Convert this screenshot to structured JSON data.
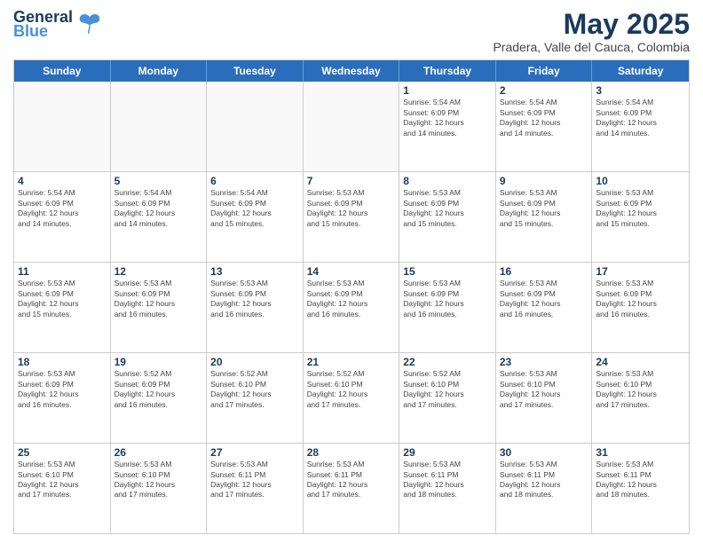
{
  "header": {
    "logo_line1": "General",
    "logo_line2": "Blue",
    "month": "May 2025",
    "location": "Pradera, Valle del Cauca, Colombia"
  },
  "weekdays": [
    "Sunday",
    "Monday",
    "Tuesday",
    "Wednesday",
    "Thursday",
    "Friday",
    "Saturday"
  ],
  "rows": [
    [
      {
        "day": "",
        "info": ""
      },
      {
        "day": "",
        "info": ""
      },
      {
        "day": "",
        "info": ""
      },
      {
        "day": "",
        "info": ""
      },
      {
        "day": "1",
        "info": "Sunrise: 5:54 AM\nSunset: 6:09 PM\nDaylight: 12 hours\nand 14 minutes."
      },
      {
        "day": "2",
        "info": "Sunrise: 5:54 AM\nSunset: 6:09 PM\nDaylight: 12 hours\nand 14 minutes."
      },
      {
        "day": "3",
        "info": "Sunrise: 5:54 AM\nSunset: 6:09 PM\nDaylight: 12 hours\nand 14 minutes."
      }
    ],
    [
      {
        "day": "4",
        "info": "Sunrise: 5:54 AM\nSunset: 6:09 PM\nDaylight: 12 hours\nand 14 minutes."
      },
      {
        "day": "5",
        "info": "Sunrise: 5:54 AM\nSunset: 6:09 PM\nDaylight: 12 hours\nand 14 minutes."
      },
      {
        "day": "6",
        "info": "Sunrise: 5:54 AM\nSunset: 6:09 PM\nDaylight: 12 hours\nand 15 minutes."
      },
      {
        "day": "7",
        "info": "Sunrise: 5:53 AM\nSunset: 6:09 PM\nDaylight: 12 hours\nand 15 minutes."
      },
      {
        "day": "8",
        "info": "Sunrise: 5:53 AM\nSunset: 6:09 PM\nDaylight: 12 hours\nand 15 minutes."
      },
      {
        "day": "9",
        "info": "Sunrise: 5:53 AM\nSunset: 6:09 PM\nDaylight: 12 hours\nand 15 minutes."
      },
      {
        "day": "10",
        "info": "Sunrise: 5:53 AM\nSunset: 6:09 PM\nDaylight: 12 hours\nand 15 minutes."
      }
    ],
    [
      {
        "day": "11",
        "info": "Sunrise: 5:53 AM\nSunset: 6:09 PM\nDaylight: 12 hours\nand 15 minutes."
      },
      {
        "day": "12",
        "info": "Sunrise: 5:53 AM\nSunset: 6:09 PM\nDaylight: 12 hours\nand 16 minutes."
      },
      {
        "day": "13",
        "info": "Sunrise: 5:53 AM\nSunset: 6:09 PM\nDaylight: 12 hours\nand 16 minutes."
      },
      {
        "day": "14",
        "info": "Sunrise: 5:53 AM\nSunset: 6:09 PM\nDaylight: 12 hours\nand 16 minutes."
      },
      {
        "day": "15",
        "info": "Sunrise: 5:53 AM\nSunset: 6:09 PM\nDaylight: 12 hours\nand 16 minutes."
      },
      {
        "day": "16",
        "info": "Sunrise: 5:53 AM\nSunset: 6:09 PM\nDaylight: 12 hours\nand 16 minutes."
      },
      {
        "day": "17",
        "info": "Sunrise: 5:53 AM\nSunset: 6:09 PM\nDaylight: 12 hours\nand 16 minutes."
      }
    ],
    [
      {
        "day": "18",
        "info": "Sunrise: 5:53 AM\nSunset: 6:09 PM\nDaylight: 12 hours\nand 16 minutes."
      },
      {
        "day": "19",
        "info": "Sunrise: 5:52 AM\nSunset: 6:09 PM\nDaylight: 12 hours\nand 16 minutes."
      },
      {
        "day": "20",
        "info": "Sunrise: 5:52 AM\nSunset: 6:10 PM\nDaylight: 12 hours\nand 17 minutes."
      },
      {
        "day": "21",
        "info": "Sunrise: 5:52 AM\nSunset: 6:10 PM\nDaylight: 12 hours\nand 17 minutes."
      },
      {
        "day": "22",
        "info": "Sunrise: 5:52 AM\nSunset: 6:10 PM\nDaylight: 12 hours\nand 17 minutes."
      },
      {
        "day": "23",
        "info": "Sunrise: 5:53 AM\nSunset: 6:10 PM\nDaylight: 12 hours\nand 17 minutes."
      },
      {
        "day": "24",
        "info": "Sunrise: 5:53 AM\nSunset: 6:10 PM\nDaylight: 12 hours\nand 17 minutes."
      }
    ],
    [
      {
        "day": "25",
        "info": "Sunrise: 5:53 AM\nSunset: 6:10 PM\nDaylight: 12 hours\nand 17 minutes."
      },
      {
        "day": "26",
        "info": "Sunrise: 5:53 AM\nSunset: 6:10 PM\nDaylight: 12 hours\nand 17 minutes."
      },
      {
        "day": "27",
        "info": "Sunrise: 5:53 AM\nSunset: 6:11 PM\nDaylight: 12 hours\nand 17 minutes."
      },
      {
        "day": "28",
        "info": "Sunrise: 5:53 AM\nSunset: 6:11 PM\nDaylight: 12 hours\nand 17 minutes."
      },
      {
        "day": "29",
        "info": "Sunrise: 5:53 AM\nSunset: 6:11 PM\nDaylight: 12 hours\nand 18 minutes."
      },
      {
        "day": "30",
        "info": "Sunrise: 5:53 AM\nSunset: 6:11 PM\nDaylight: 12 hours\nand 18 minutes."
      },
      {
        "day": "31",
        "info": "Sunrise: 5:53 AM\nSunset: 6:11 PM\nDaylight: 12 hours\nand 18 minutes."
      }
    ]
  ]
}
